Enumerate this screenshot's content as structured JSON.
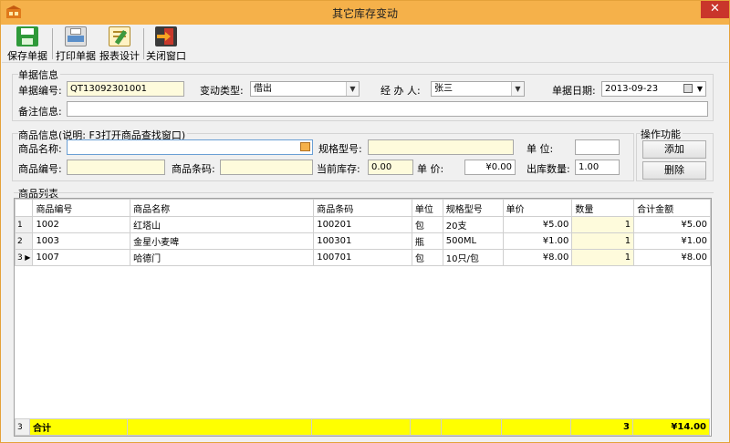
{
  "window": {
    "title": "其它库存变动",
    "close_glyph": "✕"
  },
  "toolbar": {
    "items": [
      {
        "label": "保存单据",
        "icon": "save-icon",
        "color": "#2f9a3a"
      },
      {
        "label": "打印单据",
        "icon": "print-icon",
        "color": "#5b8fc9"
      },
      {
        "label": "报表设计",
        "icon": "report-design-icon",
        "color": "#d8a632"
      },
      {
        "label": "关闭窗口",
        "icon": "exit-icon",
        "color": "#c8382b"
      }
    ]
  },
  "doc_info": {
    "section_label": "单据信息",
    "doc_no_label": "单据编号:",
    "doc_no": "QT13092301001",
    "change_type_label": "变动类型:",
    "change_type": "借出",
    "handler_label": "经 办 人:",
    "handler": "张三",
    "date_label": "单据日期:",
    "date": "2013-09-23",
    "remark_label": "备注信息:",
    "remark": ""
  },
  "product_info": {
    "section_label": "商品信息(说明: F3打开商品查找窗口)",
    "name_label": "商品名称:",
    "name": "",
    "spec_label": "规格型号:",
    "spec": "",
    "unit_label": "单    位:",
    "unit": "",
    "code_label": "商品编号:",
    "code": "",
    "barcode_label": "商品条码:",
    "barcode": "",
    "stock_label": "当前库存:",
    "stock": "0.00",
    "price_label": "单    价:",
    "price": "¥0.00",
    "out_qty_label": "出库数量:",
    "out_qty": "1.00"
  },
  "actions": {
    "section_label": "操作功能",
    "add_label": "添加",
    "delete_label": "删除"
  },
  "list": {
    "section_label": "商品列表",
    "columns": [
      "商品编号",
      "商品名称",
      "商品条码",
      "单位",
      "规格型号",
      "单价",
      "数量",
      "合计金额"
    ],
    "rows": [
      {
        "idx": "1",
        "code": "1002",
        "name": "红塔山",
        "barcode": "100201",
        "unit": "包",
        "spec": "20支",
        "price": "¥5.00",
        "qty": "1",
        "total": "¥5.00"
      },
      {
        "idx": "2",
        "code": "1003",
        "name": "金星小麦啤",
        "barcode": "100301",
        "unit": "瓶",
        "spec": "500ML",
        "price": "¥1.00",
        "qty": "1",
        "total": "¥1.00"
      },
      {
        "idx": "3",
        "code": "1007",
        "name": "哈德门",
        "barcode": "100701",
        "unit": "包",
        "spec": "10只/包",
        "price": "¥8.00",
        "qty": "1",
        "total": "¥8.00"
      }
    ],
    "footer": {
      "idx": "3",
      "label": "合计",
      "qty": "3",
      "total": "¥14.00"
    }
  }
}
